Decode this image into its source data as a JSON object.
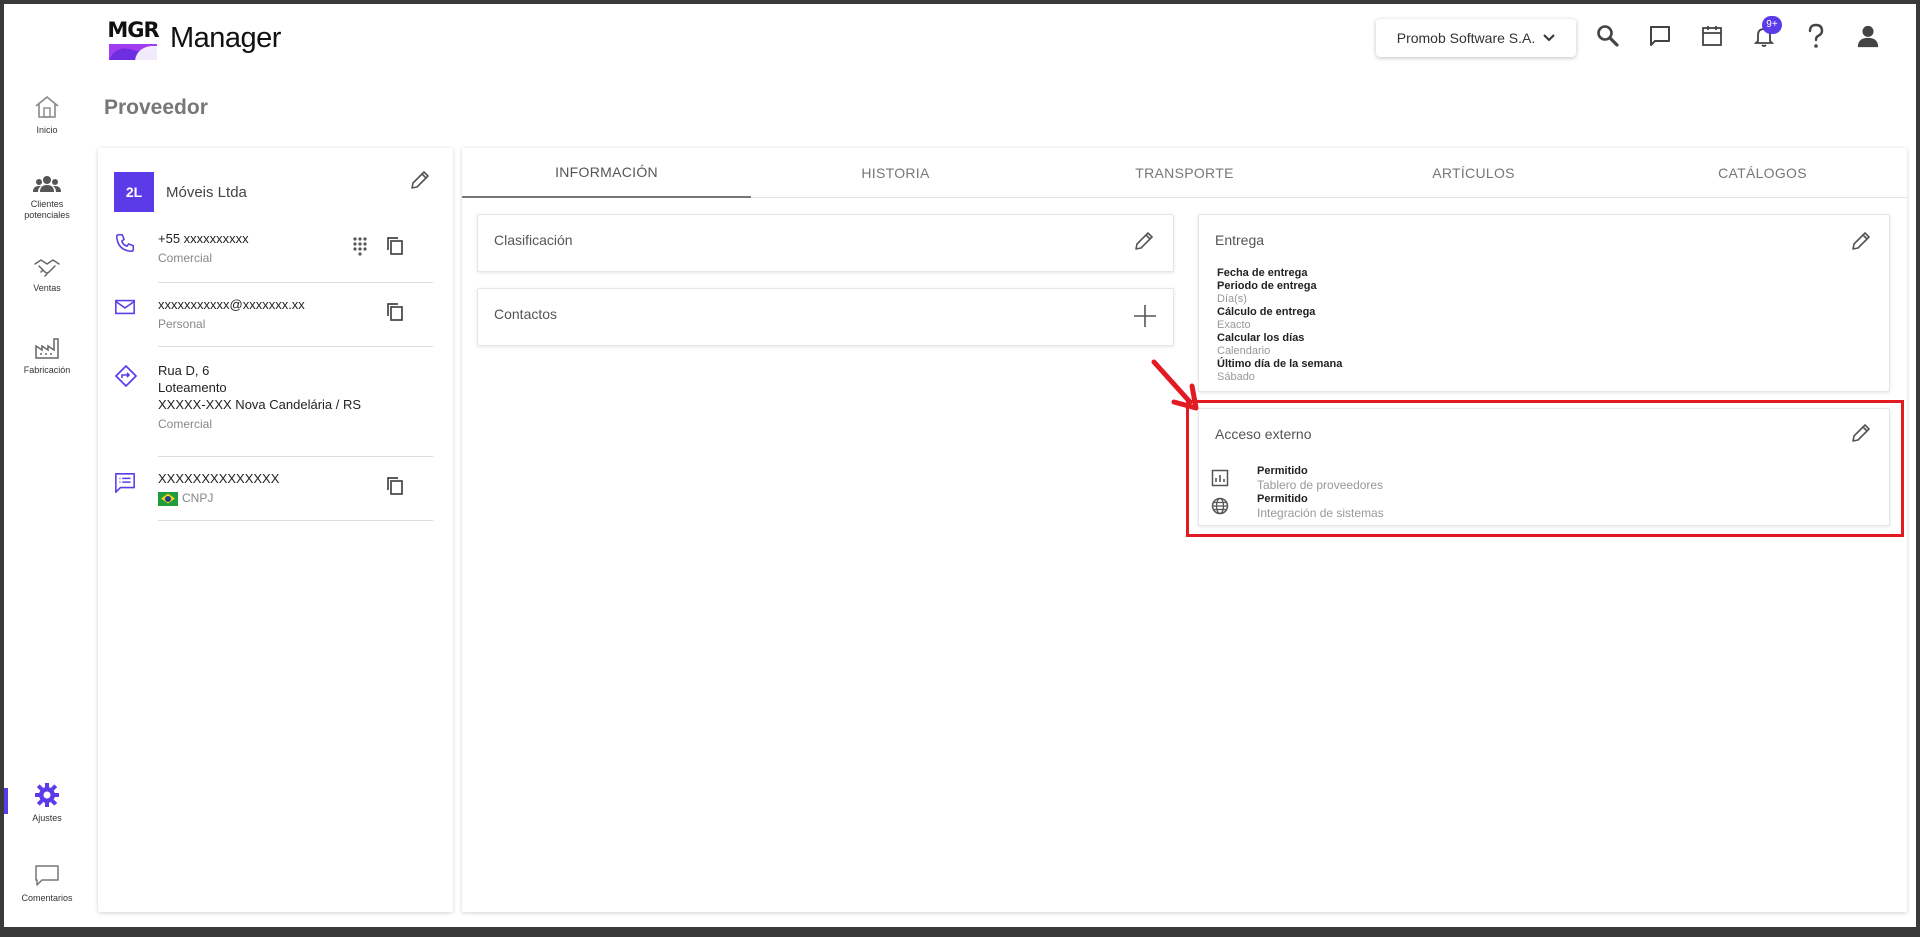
{
  "header": {
    "logo_text": "MGR",
    "app_title": "Manager",
    "company": "Promob Software S.A.",
    "notification_badge": "9+"
  },
  "sidebar": {
    "items": [
      {
        "label": "Inicio",
        "icon": "home-icon"
      },
      {
        "label": "Clientes potenciales",
        "icon": "people-icon"
      },
      {
        "label": "Ventas",
        "icon": "handshake-icon"
      },
      {
        "label": "Fabricación",
        "icon": "factory-icon"
      },
      {
        "label": "Ajustes",
        "icon": "gear-icon",
        "active": true
      },
      {
        "label": "Comentarios",
        "icon": "comment-icon"
      }
    ]
  },
  "page_title": "Proveedor",
  "supplier": {
    "avatar": "2L",
    "name": "Móveis Ltda",
    "phone": {
      "value": "+55 xxxxxxxxxx",
      "type": "Comercial"
    },
    "email": {
      "value": "xxxxxxxxxxx@xxxxxxx.xx",
      "type": "Personal"
    },
    "address": {
      "line1": "Rua D, 6",
      "line2": "Loteamento",
      "line3": "XXXXX-XXX Nova Candelária / RS",
      "type": "Comercial"
    },
    "document": {
      "value": "XXXXXXXXXXXXXX",
      "type": "CNPJ"
    }
  },
  "tabs": [
    "INFORMACIÓN",
    "HISTORIA",
    "TRANSPORTE",
    "ARTÍCULOS",
    "CATÁLOGOS"
  ],
  "panels": {
    "clasificacion": {
      "title": "Clasificación"
    },
    "contactos": {
      "title": "Contactos"
    },
    "entrega": {
      "title": "Entrega",
      "fields": [
        {
          "label": "Fecha de entrega",
          "value": ""
        },
        {
          "label": "Periodo de entrega",
          "value": "Día(s)"
        },
        {
          "label": "Cálculo de entrega",
          "value": "Exacto"
        },
        {
          "label": "Calcular los días",
          "value": "Calendario"
        },
        {
          "label": "Último día de la semana",
          "value": "Sábado"
        }
      ]
    },
    "acceso_externo": {
      "title": "Acceso externo",
      "items": [
        {
          "status": "Permitido",
          "label": "Tablero de proveedores",
          "icon": "dashboard-icon"
        },
        {
          "status": "Permitido",
          "label": "Integración de sistemas",
          "icon": "globe-icon"
        }
      ]
    }
  },
  "colors": {
    "accent": "#5b3be8",
    "highlight": "#e21b23"
  }
}
